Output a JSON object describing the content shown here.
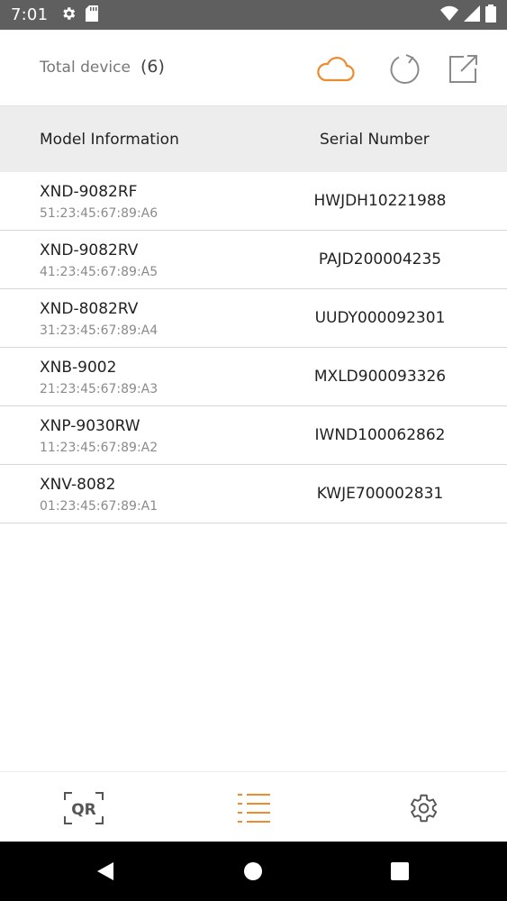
{
  "status_bar": {
    "time": "7:01",
    "left_icons": [
      "settings-icon",
      "sd-card-icon"
    ],
    "right_icons": [
      "wifi-icon",
      "signal-icon",
      "battery-icon"
    ]
  },
  "header": {
    "total_label": "Total device",
    "total_count": "(6)",
    "actions": [
      "cloud-icon",
      "refresh-icon",
      "export-icon"
    ],
    "accent_color": "#ef8a2d"
  },
  "table": {
    "columns": [
      "Model Information",
      "Serial Number"
    ],
    "rows": [
      {
        "model": "XND-9082RF",
        "mac": "51:23:45:67:89:A6",
        "serial": "HWJDH10221988"
      },
      {
        "model": "XND-9082RV",
        "mac": "41:23:45:67:89:A5",
        "serial": "PAJD200004235"
      },
      {
        "model": "XND-8082RV",
        "mac": "31:23:45:67:89:A4",
        "serial": "UUDY000092301"
      },
      {
        "model": "XNB-9002",
        "mac": "21:23:45:67:89:A3",
        "serial": "MXLD900093326"
      },
      {
        "model": "XNP-9030RW",
        "mac": "11:23:45:67:89:A2",
        "serial": "IWND100062862"
      },
      {
        "model": "XNV-8082",
        "mac": "01:23:45:67:89:A1",
        "serial": "KWJE700002831"
      }
    ]
  },
  "bottom_nav": {
    "qr_label": "QR",
    "items": [
      "qr-scan-icon",
      "list-icon",
      "settings-icon"
    ],
    "active": "list-icon"
  },
  "system_nav": [
    "back-icon",
    "home-icon",
    "recents-icon"
  ]
}
